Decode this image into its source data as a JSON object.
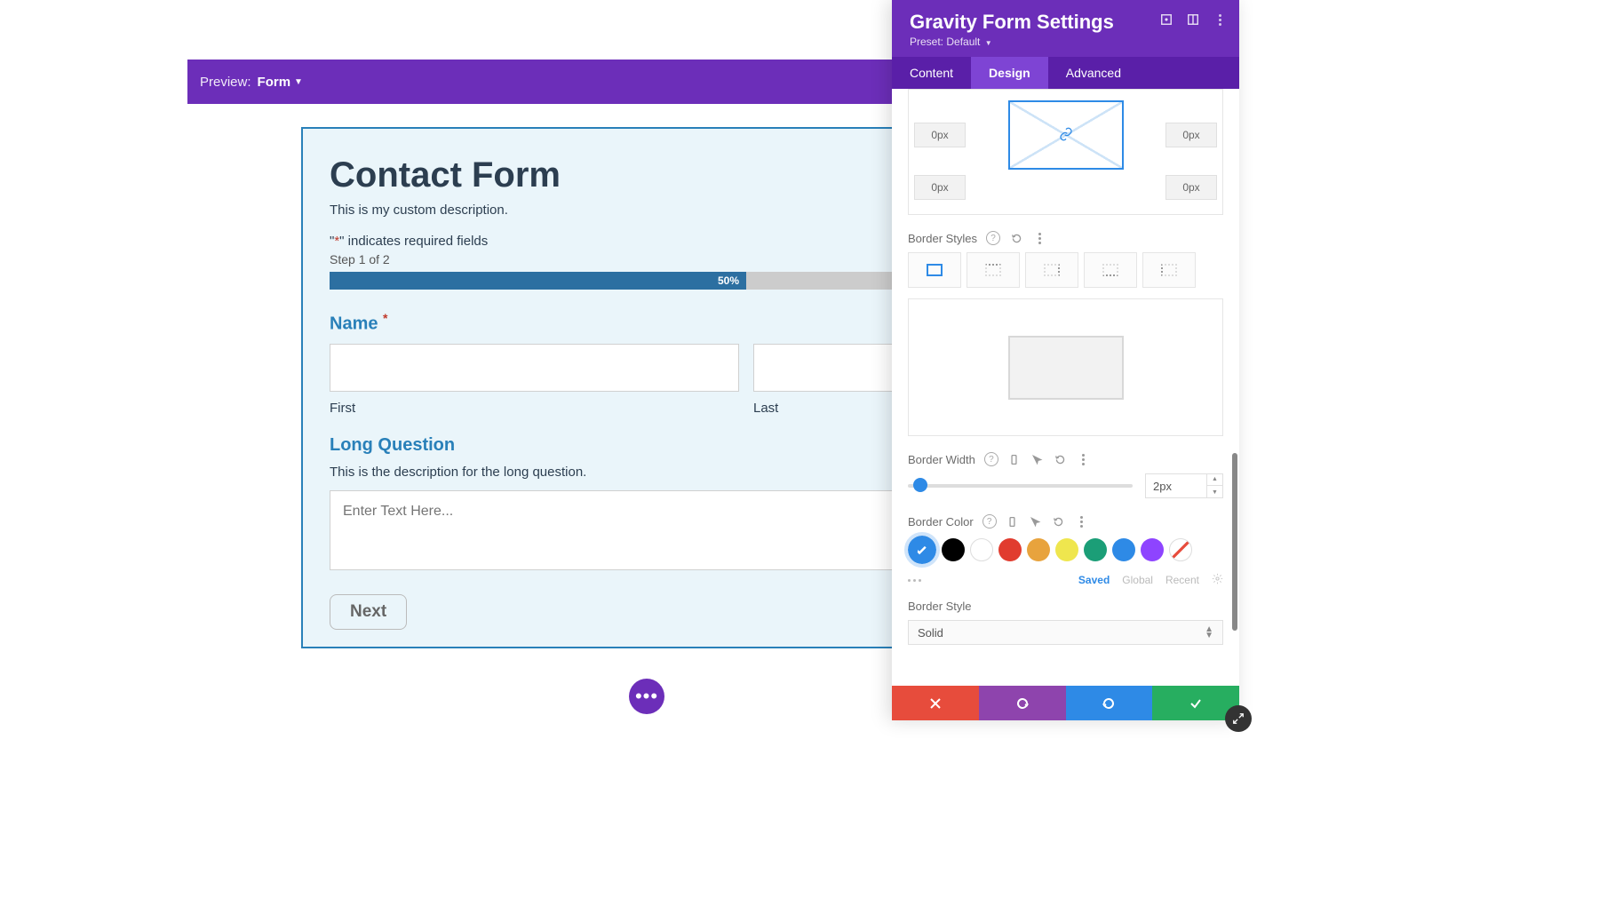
{
  "preview": {
    "label": "Preview:",
    "value": "Form"
  },
  "form": {
    "title": "Contact Form",
    "description": "This is my custom description.",
    "required_prefix": "\"",
    "required_ast": "*",
    "required_suffix": "\" indicates required fields",
    "step": "Step 1 of 2",
    "progress": "50%",
    "name_label": "Name",
    "first": "First",
    "last": "Last",
    "lq_label": "Long Question",
    "lq_desc": "This is the description for the long question.",
    "lq_placeholder": "Enter Text Here...",
    "next": "Next"
  },
  "panel": {
    "title": "Gravity Form Settings",
    "preset": "Preset: Default",
    "tabs": [
      "Content",
      "Design",
      "Advanced"
    ],
    "px": "0px",
    "border_styles": "Border Styles",
    "border_width": "Border Width",
    "border_width_value": "2px",
    "border_color": "Border Color",
    "colors": [
      "#2e8ae6",
      "#000000",
      "#ffffff",
      "#e13c2f",
      "#e8a33d",
      "#efe64e",
      "#1b9e77",
      "#2e8ae6",
      "#8e44ff"
    ],
    "saved": "Saved",
    "global": "Global",
    "recent": "Recent",
    "border_style": "Border Style",
    "border_style_value": "Solid"
  }
}
